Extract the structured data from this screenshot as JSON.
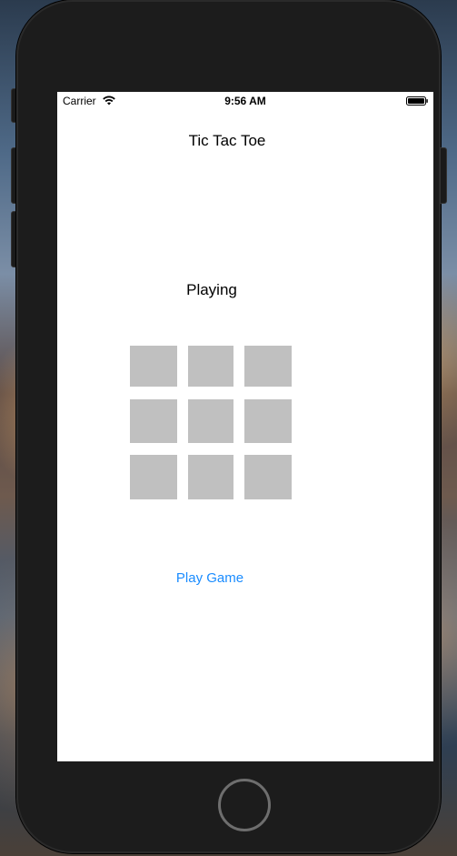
{
  "status_bar": {
    "carrier": "Carrier",
    "time": "9:56 AM",
    "wifi_icon": "wifi-icon",
    "battery_icon": "battery-icon"
  },
  "app": {
    "title": "Tic Tac Toe",
    "status": "Playing",
    "play_button_label": "Play Game"
  },
  "board": {
    "rows": 3,
    "cols": 3,
    "cells": [
      "",
      "",
      "",
      "",
      "",
      "",
      "",
      "",
      ""
    ]
  },
  "colors": {
    "cell": "#c0c0c0",
    "link": "#1a8cff",
    "screen": "#ffffff",
    "bezel": "#1c1c1c"
  }
}
